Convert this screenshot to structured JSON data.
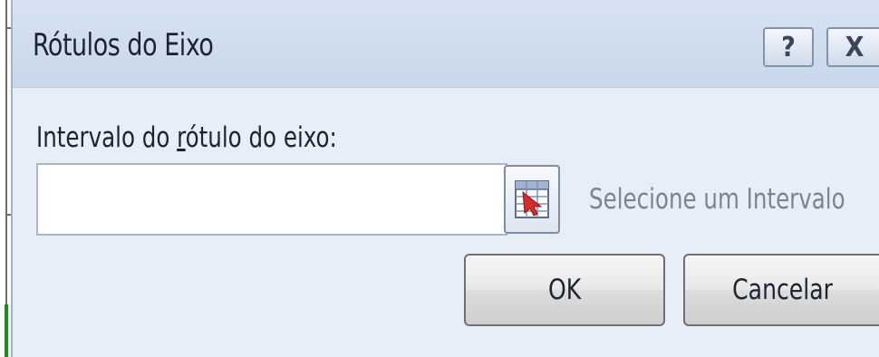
{
  "dialog": {
    "title": "Rótulos do Eixo",
    "help_button": "?",
    "close_button": "X"
  },
  "range": {
    "label_before": "Intervalo do ",
    "label_accel": "r",
    "label_after": "ótulo do eixo:",
    "value": "",
    "hint": "Selecione um Intervalo"
  },
  "buttons": {
    "ok": "OK",
    "cancel": "Cancelar"
  },
  "icons": {
    "range_picker": "range-select-icon"
  }
}
